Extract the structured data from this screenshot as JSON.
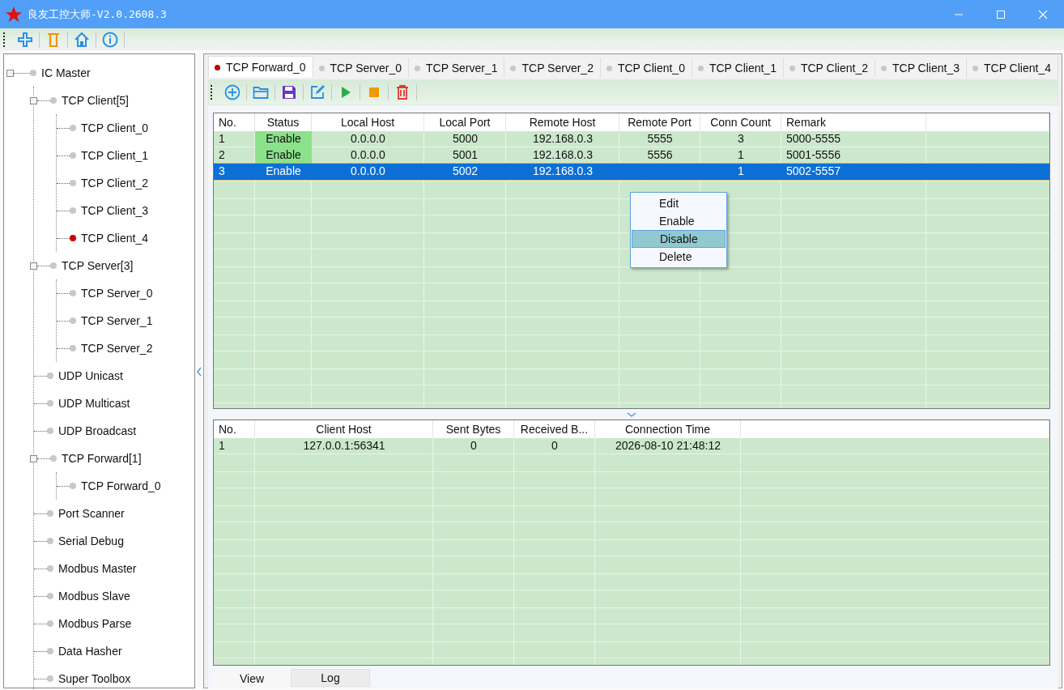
{
  "window": {
    "title": "良友工控大师-V2.0.2608.3"
  },
  "sidebar": {
    "tree": [
      {
        "label": "IC Master",
        "active": false,
        "expanded": true,
        "children": [
          {
            "label": "TCP Client[5]",
            "active": false,
            "expanded": true,
            "children": [
              {
                "label": "TCP Client_0",
                "active": false
              },
              {
                "label": "TCP Client_1",
                "active": false
              },
              {
                "label": "TCP Client_2",
                "active": false
              },
              {
                "label": "TCP Client_3",
                "active": false
              },
              {
                "label": "TCP Client_4",
                "active": true
              }
            ]
          },
          {
            "label": "TCP Server[3]",
            "active": false,
            "expanded": true,
            "children": [
              {
                "label": "TCP Server_0",
                "active": false
              },
              {
                "label": "TCP Server_1",
                "active": false
              },
              {
                "label": "TCP Server_2",
                "active": false
              }
            ]
          },
          {
            "label": "UDP Unicast",
            "active": false
          },
          {
            "label": "UDP Multicast",
            "active": false
          },
          {
            "label": "UDP Broadcast",
            "active": false
          },
          {
            "label": "TCP Forward[1]",
            "active": false,
            "expanded": true,
            "children": [
              {
                "label": "TCP Forward_0",
                "active": false
              }
            ]
          },
          {
            "label": "Port Scanner",
            "active": false
          },
          {
            "label": "Serial Debug",
            "active": false
          },
          {
            "label": "Modbus Master",
            "active": false
          },
          {
            "label": "Modbus Slave",
            "active": false
          },
          {
            "label": "Modbus Parse",
            "active": false
          },
          {
            "label": "Data Hasher",
            "active": false
          },
          {
            "label": "Super Toolbox",
            "active": false
          }
        ]
      }
    ]
  },
  "tabs": [
    {
      "label": "TCP Forward_0",
      "selected": true
    },
    {
      "label": "TCP Server_0",
      "selected": false
    },
    {
      "label": "TCP Server_1",
      "selected": false
    },
    {
      "label": "TCP Server_2",
      "selected": false
    },
    {
      "label": "TCP Client_0",
      "selected": false
    },
    {
      "label": "TCP Client_1",
      "selected": false
    },
    {
      "label": "TCP Client_2",
      "selected": false
    },
    {
      "label": "TCP Client_3",
      "selected": false
    },
    {
      "label": "TCP Client_4",
      "selected": false
    }
  ],
  "forward_table": {
    "columns": [
      "No.",
      "Status",
      "Local Host",
      "Local Port",
      "Remote Host",
      "Remote Port",
      "Conn Count",
      "Remark"
    ],
    "rows": [
      {
        "cells": [
          "1",
          "Enable",
          "0.0.0.0",
          "5000",
          "192.168.0.3",
          "5555",
          "3",
          "5000-5555"
        ],
        "enabled": true,
        "selected": false
      },
      {
        "cells": [
          "2",
          "Enable",
          "0.0.0.0",
          "5001",
          "192.168.0.3",
          "5556",
          "1",
          "5001-5556"
        ],
        "enabled": true,
        "selected": false
      },
      {
        "cells": [
          "3",
          "Enable",
          "0.0.0.0",
          "5002",
          "192.168.0.3",
          null,
          "1",
          "5002-5557"
        ],
        "enabled": true,
        "selected": true
      }
    ]
  },
  "context_menu": {
    "items": [
      {
        "label": "Edit",
        "selected": false
      },
      {
        "label": "Enable",
        "selected": false
      },
      {
        "label": "Disable",
        "selected": true
      },
      {
        "label": "Delete",
        "selected": false
      }
    ]
  },
  "client_table": {
    "columns": [
      "No.",
      "Client Host",
      "Sent Bytes",
      "Received B...",
      "Connection Time"
    ],
    "rows": [
      {
        "cells": [
          "1",
          "127.0.0.1:56341",
          "0",
          "0",
          "2026-08-10 21:48:12"
        ],
        "selected": false
      }
    ]
  },
  "bottom_tabs": [
    {
      "label": "View",
      "selected": true
    },
    {
      "label": "Log",
      "selected": false
    }
  ]
}
